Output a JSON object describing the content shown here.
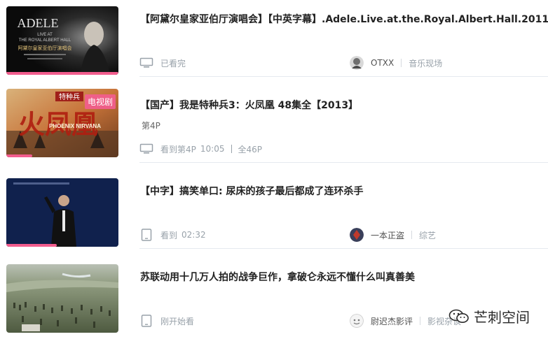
{
  "items": [
    {
      "title": "【阿黛尔皇家亚伯厅演唱会】【中英字幕】.Adele.Live.at.the.Royal.Albert.Hall.2011",
      "subtitle": "",
      "progress": 1.0,
      "device": "desktop-icon",
      "status": "已看完",
      "time": "",
      "total": "",
      "up_name": "OTXX",
      "category": "音乐现场",
      "thumb_text": [
        "ADELE",
        "LIVE AT",
        "THE ROYAL ALBERT HALL",
        "阿黛尔皇家亚伯厅演唱会"
      ],
      "badge": ""
    },
    {
      "title": "【国产】我是特种兵3：火凤凰 48集全【2013】",
      "subtitle": "第4P",
      "progress": 0.23,
      "device": "desktop-icon",
      "status": "看到第4P",
      "time": "10:05",
      "total": "全46P",
      "up_name": "",
      "category": "",
      "thumb_text": [
        "特种兵",
        "火凤凰",
        "PHOENIX NIRVANA"
      ],
      "badge": "电视剧"
    },
    {
      "title": "【中字】搞笑单口: 尿床的孩子最后都成了连环杀手",
      "subtitle": "",
      "progress": 0.45,
      "device": "tablet-icon",
      "status": "看到",
      "time": "02:32",
      "total": "",
      "up_name": "一本正盗",
      "category": "综艺",
      "thumb_text": [],
      "badge": ""
    },
    {
      "title": "苏联动用十几万人拍的战争巨作，拿破仑永远不懂什么叫真善美",
      "subtitle": "",
      "progress": 0,
      "device": "tablet-icon",
      "status": "刚开始看",
      "time": "",
      "total": "",
      "up_name": "尉迟杰影评",
      "category": "影视杂谈",
      "thumb_text": [],
      "badge": ""
    }
  ],
  "watermark": "芒刺空间",
  "colors": {
    "accent": "#f25d8e",
    "meta": "#99a2aa",
    "divider": "#e5e9ef"
  }
}
